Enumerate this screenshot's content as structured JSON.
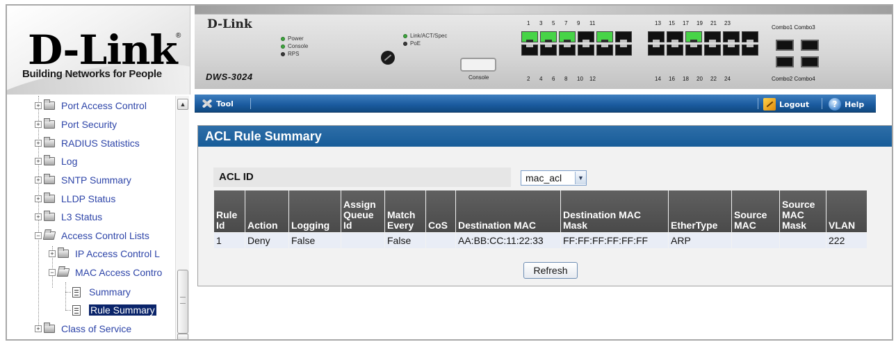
{
  "brand": {
    "name": "D-Link",
    "registered": "®",
    "tagline": "Building Networks for People"
  },
  "device": {
    "logo": "D-Link",
    "model": "DWS-3024",
    "leds_left": [
      "Power",
      "Console",
      "RPS"
    ],
    "leds_right": [
      "Link/ACT/Spec",
      "PoE"
    ],
    "console_label": "Console",
    "top_port_numbers_a": [
      "1",
      "3",
      "5",
      "7",
      "9",
      "11"
    ],
    "bottom_port_numbers_a": [
      "2",
      "4",
      "6",
      "8",
      "10",
      "12"
    ],
    "top_port_numbers_b": [
      "13",
      "15",
      "17",
      "19",
      "21",
      "23"
    ],
    "bottom_port_numbers_b": [
      "14",
      "16",
      "18",
      "20",
      "22",
      "24"
    ],
    "combo_top": "Combo1 Combo3",
    "combo_bottom": "Combo2 Combo4"
  },
  "toolbar": {
    "tool_label": "Tool",
    "logout_label": "Logout",
    "help_label": "Help"
  },
  "sidebar": {
    "items": [
      {
        "label": "Port Access Control"
      },
      {
        "label": "Port Security"
      },
      {
        "label": "RADIUS Statistics"
      },
      {
        "label": "Log"
      },
      {
        "label": "SNTP Summary"
      },
      {
        "label": "LLDP Status"
      },
      {
        "label": "L3 Status"
      },
      {
        "label": "Access Control Lists"
      },
      {
        "label": "IP Access Control L"
      },
      {
        "label": "MAC Access Contro"
      },
      {
        "label": "Summary"
      },
      {
        "label": "Rule Summary"
      },
      {
        "label": "Class of Service"
      }
    ]
  },
  "main": {
    "title": "ACL Rule Summary",
    "acl_id_label": "ACL ID",
    "acl_id_value": "mac_acl",
    "table": {
      "headers": [
        "Rule Id",
        "Action",
        "Logging",
        "Assign Queue Id",
        "Match Every",
        "CoS",
        "Destination MAC",
        "Destination MAC Mask",
        "EtherType",
        "Source MAC",
        "Source MAC Mask",
        "VLAN"
      ],
      "rows": [
        [
          "1",
          "Deny",
          "False",
          "",
          "False",
          "",
          "AA:BB:CC:11:22:33",
          "FF:FF:FF:FF:FF:FF",
          "ARP",
          "",
          "",
          "222"
        ]
      ]
    },
    "refresh_label": "Refresh"
  },
  "colors": {
    "toolbar_blue": "#1a5a9e",
    "title_blue": "#2e6ea8",
    "tree_link": "#2d44a8",
    "selection": "#0a246a",
    "header_gray": "#555555"
  }
}
